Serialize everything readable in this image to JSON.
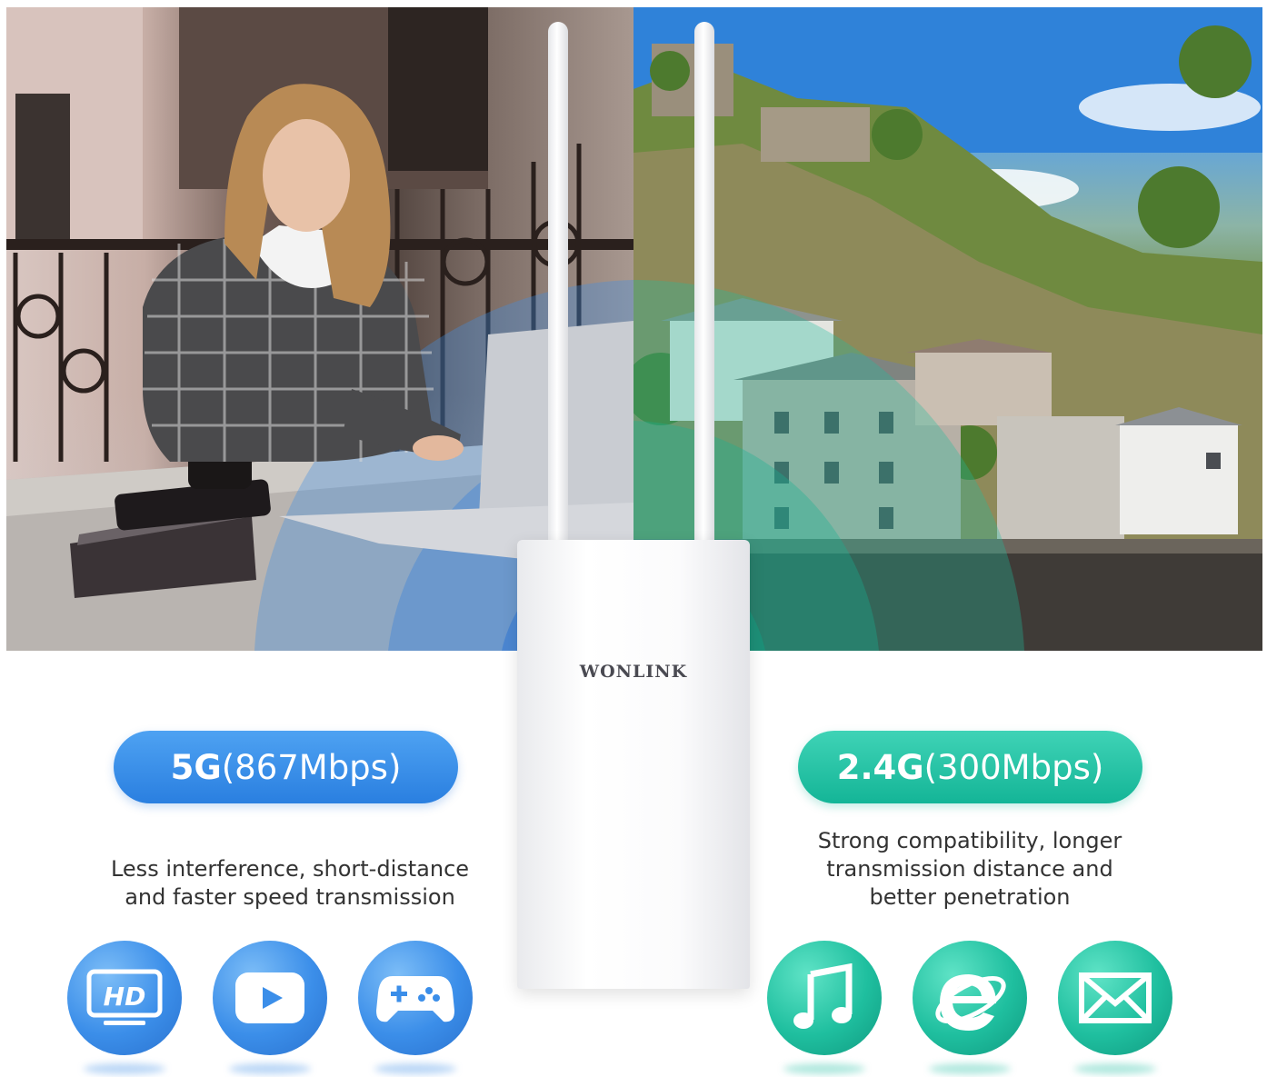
{
  "brand": {
    "name": "WONLINK"
  },
  "bands": {
    "five_g": {
      "band": "5G",
      "speed": "(867Mbps)",
      "description_line1": "Less interference, short-distance",
      "description_line2": "and faster speed transmission",
      "color": "#2a7fe0",
      "icons": [
        "hd-icon",
        "play-icon",
        "gamepad-icon"
      ]
    },
    "two_four_g": {
      "band": "2.4G",
      "speed": "(300Mbps)",
      "description_line1": "Strong compatibility, longer",
      "description_line2": "transmission distance and",
      "description_line3": "better penetration",
      "color": "#14b597",
      "icons": [
        "music-note-icon",
        "browser-icon",
        "mail-icon"
      ]
    }
  },
  "hd_icon_text": "HD"
}
